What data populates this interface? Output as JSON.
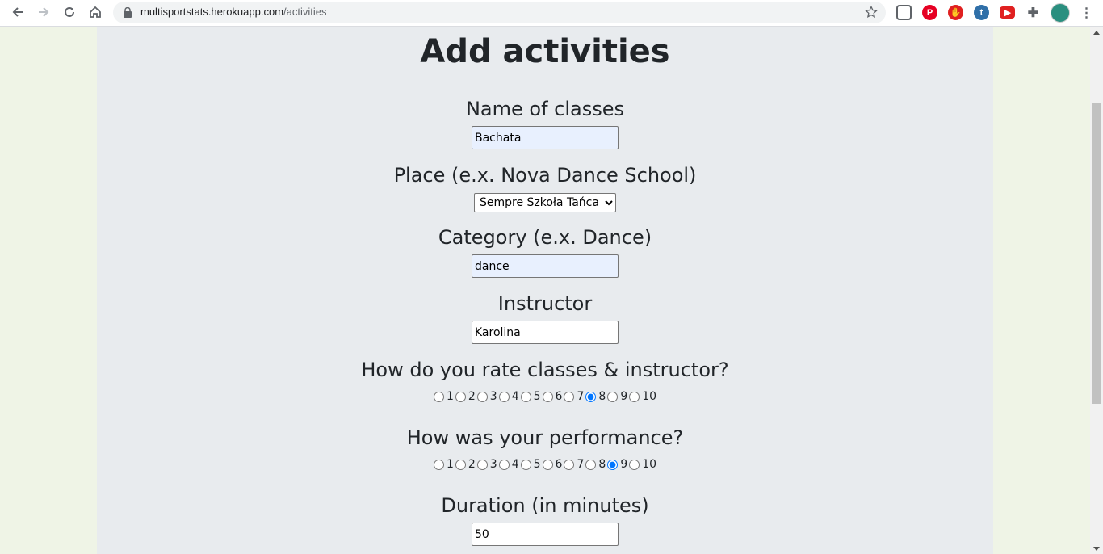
{
  "browser": {
    "url_domain": "multisportstats.herokuapp.com",
    "url_path": "/activities",
    "extensions": [
      "pocket-icon",
      "pinterest-icon",
      "adblock-icon",
      "t-extension-icon",
      "youtube-icon",
      "puzzle-icon",
      "profile-icon"
    ]
  },
  "form": {
    "title": "Add activities",
    "name_label": "Name of classes",
    "name_value": "Bachata",
    "place_label": "Place (e.x. Nova Dance School)",
    "place_value": "Sempre Szkoła Tańca",
    "category_label": "Category (e.x. Dance)",
    "category_value": "dance",
    "instructor_label": "Instructor",
    "instructor_value": "Karolina",
    "rate_label": "How do you rate classes & instructor?",
    "rate_selected": 8,
    "performance_label": "How was your performance?",
    "performance_selected": 9,
    "duration_label": "Duration (in minutes)",
    "duration_value": "50",
    "options": [
      "1",
      "2",
      "3",
      "4",
      "5",
      "6",
      "7",
      "8",
      "9",
      "10"
    ]
  },
  "colors": {
    "page_bg": "#eff4e6",
    "content_bg": "#e8ebee",
    "autofill_bg": "#e8f0fe"
  }
}
